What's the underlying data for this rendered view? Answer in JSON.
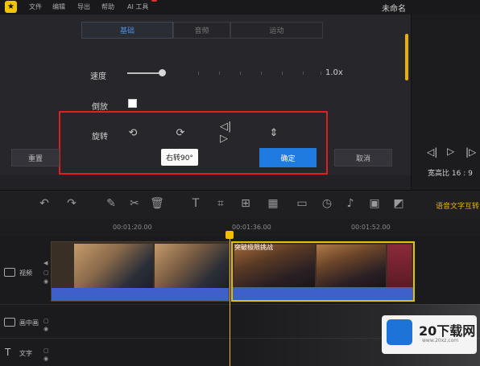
{
  "titlebar": {
    "menu": [
      "文件",
      "编辑",
      "导出",
      "帮助",
      "AI 工具"
    ],
    "project_title": "未命名"
  },
  "panel": {
    "tabs": [
      "基础",
      "音频",
      "运动"
    ],
    "speed_label": "速度",
    "speed_value": "1.0x",
    "speed_fraction": 0.18,
    "reverse_label": "倒放",
    "rotate_label": "旋转",
    "rotate_icons": [
      "rotate-ccw-icon",
      "rotate-cw-icon",
      "flip-horizontal-icon",
      "flip-vertical-icon"
    ],
    "tooltip": "右转90°",
    "reset_button": "重置",
    "confirm_button": "确定",
    "cancel_button": "取消"
  },
  "player": {
    "ratio_label": "宽高比",
    "ratio_value": "16 : 9"
  },
  "toolbar": {
    "smart_subtitle": "语音文字互转"
  },
  "timeline": {
    "ruler_times": [
      "00:01:20.00",
      "00:01:36.00",
      "00:01:52.00"
    ],
    "tracks": [
      "视频",
      "画中画",
      "文字"
    ],
    "clip2_title": "突破极限挑战"
  },
  "watermark": {
    "brand": "20下载网",
    "url": "www.20xz.com"
  },
  "colors": {
    "accent": "#1f7be0",
    "highlight": "#e02020",
    "playhead": "#f0c000",
    "waveform": "#3f5fc9"
  }
}
